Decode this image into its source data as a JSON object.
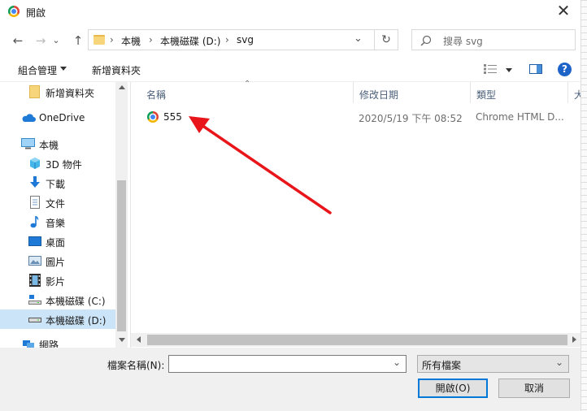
{
  "window": {
    "title": "開啟",
    "close_glyph": "✕"
  },
  "nav": {
    "back": "←",
    "forward": "→",
    "dropdown": "⌄",
    "up": "↑"
  },
  "address": {
    "sep": "›",
    "crumbs": [
      "本機",
      "本機磁碟 (D:)",
      "svg"
    ],
    "chevron": "⌄",
    "refresh": "↻"
  },
  "search": {
    "placeholder": "搜尋 svg"
  },
  "toolbar": {
    "organize": "組合管理",
    "new_folder": "新增資料夾",
    "help": "?"
  },
  "sidebar": {
    "items": [
      {
        "label": "新增資料夾",
        "icon": "folder-icon"
      },
      {
        "label": "OneDrive",
        "icon": "cloud-icon"
      },
      {
        "label": "本機",
        "icon": "computer-icon"
      },
      {
        "label": "3D 物件",
        "icon": "cube-icon"
      },
      {
        "label": "下載",
        "icon": "download-icon"
      },
      {
        "label": "文件",
        "icon": "document-icon"
      },
      {
        "label": "音樂",
        "icon": "music-icon"
      },
      {
        "label": "桌面",
        "icon": "desktop-icon"
      },
      {
        "label": "圖片",
        "icon": "pictures-icon"
      },
      {
        "label": "影片",
        "icon": "video-icon"
      },
      {
        "label": "本機磁碟 (C:)",
        "icon": "drive-icon"
      },
      {
        "label": "本機磁碟 (D:)",
        "icon": "drive-icon",
        "selected": true
      },
      {
        "label": "網路",
        "icon": "network-icon"
      }
    ]
  },
  "columns": {
    "name": "名稱",
    "date": "修改日期",
    "type": "類型",
    "size": "大"
  },
  "files": [
    {
      "name": "555",
      "date": "2020/5/19 下午 08:52",
      "type": "Chrome HTML D..."
    }
  ],
  "footer": {
    "filename_label": "檔案名稱(N):",
    "filename_value": "",
    "filter": "所有檔案",
    "open": "開啟(O)",
    "cancel": "取消"
  },
  "colors": {
    "accent": "#0078d7",
    "selected": "#cce4f7",
    "annotation_arrow": "#e8161b"
  }
}
